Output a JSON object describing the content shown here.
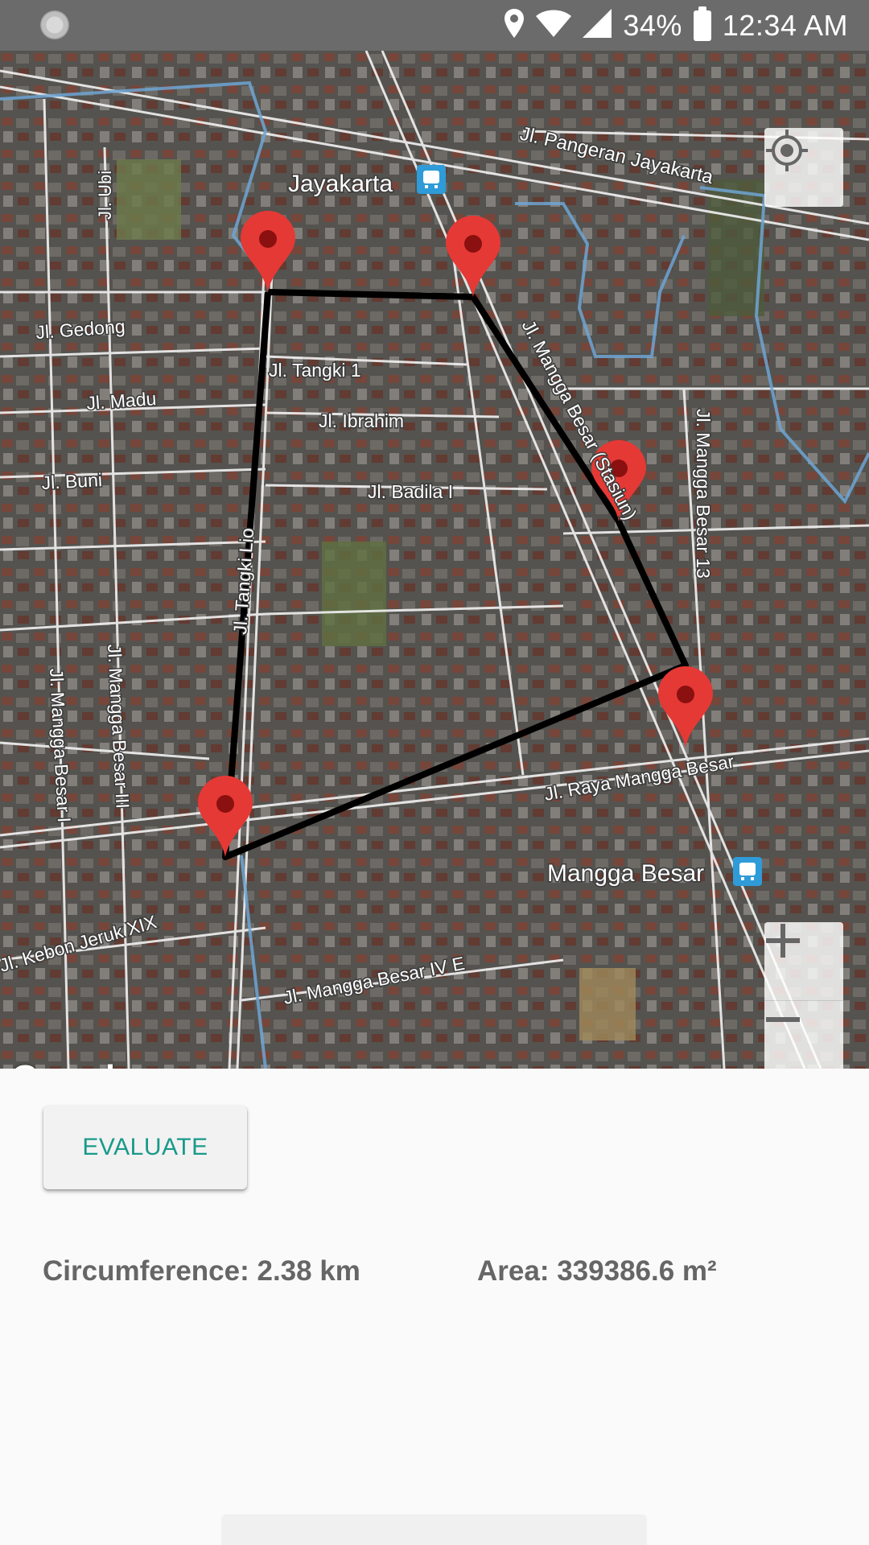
{
  "status_bar": {
    "battery": "34%",
    "time": "12:34 AM",
    "icons": [
      "loading-circle-icon",
      "location-pin-icon",
      "wifi-icon",
      "cell-signal-icon",
      "battery-charging-icon"
    ]
  },
  "map": {
    "station_labels": [
      "Jayakarta",
      "Mangga Besar"
    ],
    "street_labels": [
      "Jl. Pangeran Jayakarta",
      "Jl. Ubi",
      "Jl. Gedong",
      "Jl. Madu",
      "Jl. Buni",
      "Jl. Tangki 1",
      "Jl. Ibrahim",
      "Jl. Badila I",
      "Jl. Tangki Lio",
      "Jl. Mangga Besar (Stasiun)",
      "Jl. Mangga Besar 13",
      "Jl. Mangga Besar III",
      "Jl. Mangga Besar I",
      "Jl. Raya Mangga Besar",
      "Jl. Kebon Jeruk XIX",
      "Jl. Mangga Besar IV E"
    ],
    "marker_count": 5,
    "polygon_color": "#000000",
    "marker_color": "#e53935",
    "attribution": "Google",
    "zoom_in_label": "+",
    "zoom_out_label": "−"
  },
  "actions": {
    "evaluate_label": "EVALUATE"
  },
  "results": {
    "circumference": "Circumference: 2.38 km",
    "area": "Area: 339386.6 m²"
  },
  "colors": {
    "accent": "#199a8a",
    "status_bar": "#6b6b6b"
  }
}
